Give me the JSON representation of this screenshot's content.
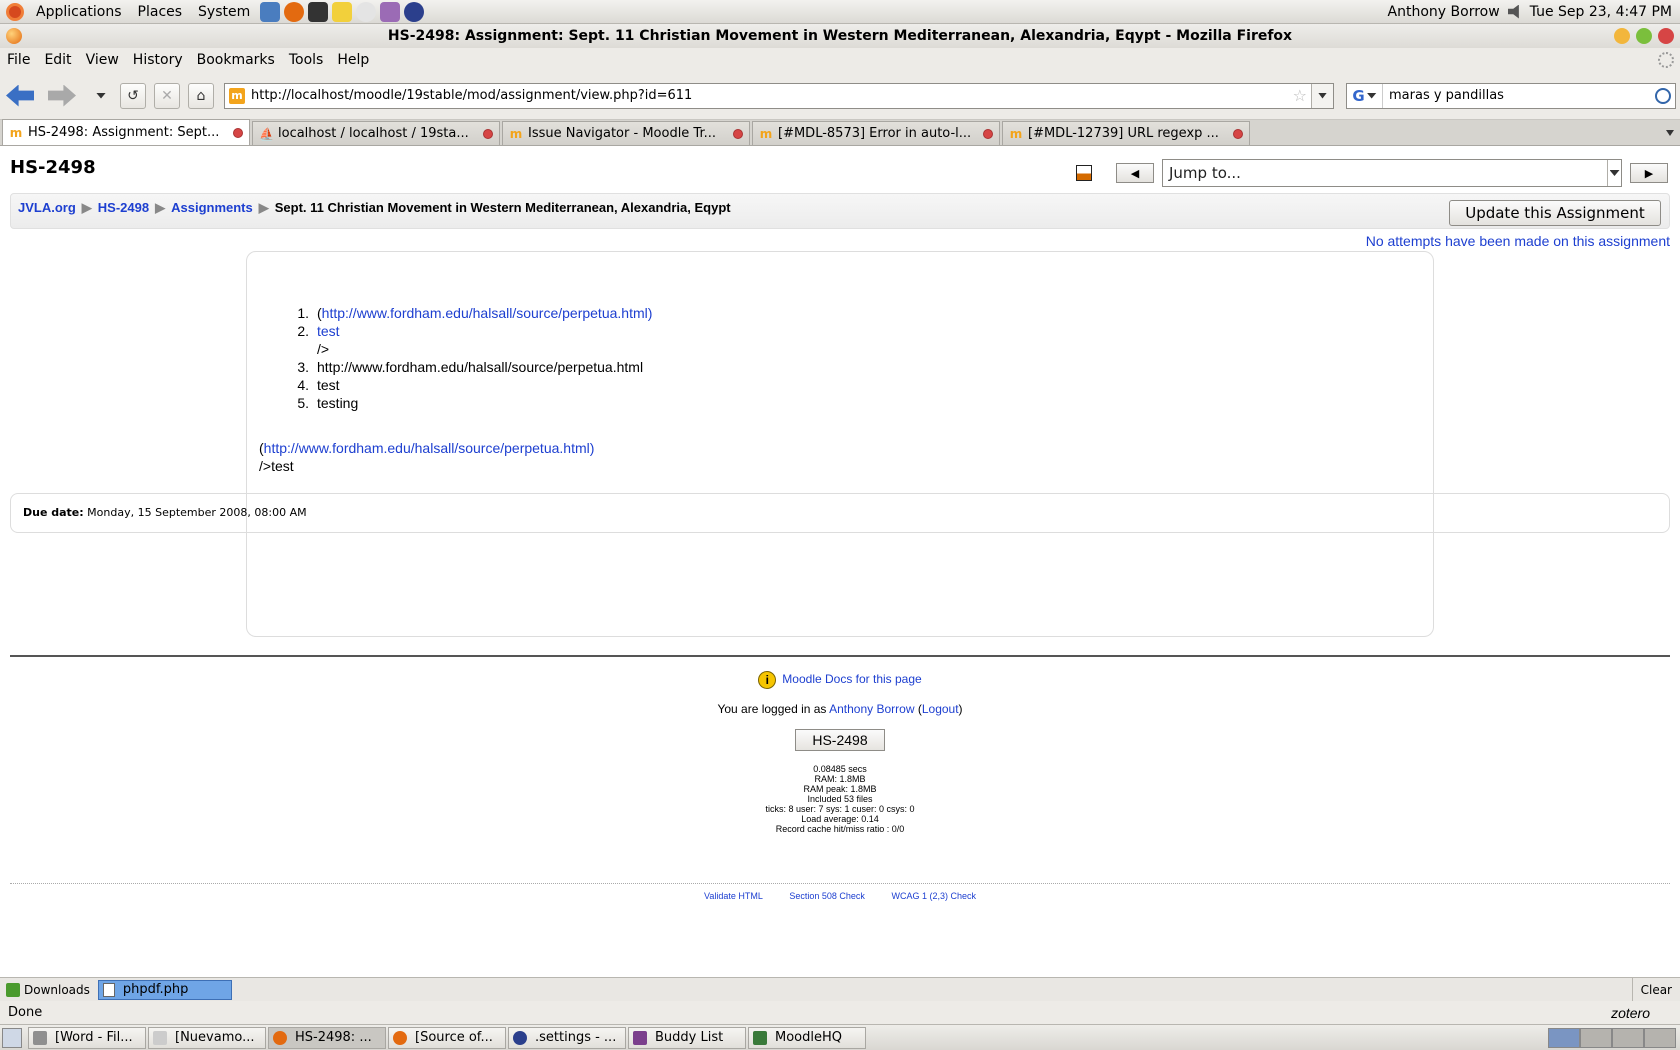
{
  "panel": {
    "menus": [
      "Applications",
      "Places",
      "System"
    ],
    "user": "Anthony Borrow",
    "datetime": "Tue Sep 23,  4:47 PM"
  },
  "window": {
    "title": "HS-2498: Assignment: Sept. 11 Christian Movement in Western Mediterranean, Alexandria, Eqypt - Mozilla Firefox"
  },
  "menubar": [
    "File",
    "Edit",
    "View",
    "History",
    "Bookmarks",
    "Tools",
    "Help"
  ],
  "nav": {
    "url": "http://localhost/moodle/19stable/mod/assignment/view.php?id=611",
    "search": "maras y pandillas"
  },
  "tabs": [
    {
      "label": "HS-2498: Assignment: Sept...",
      "active": true
    },
    {
      "label": "localhost / localhost / 19sta...",
      "active": false
    },
    {
      "label": "Issue Navigator - Moodle Tr...",
      "active": false
    },
    {
      "label": "[#MDL-8573] Error in auto-l...",
      "active": false
    },
    {
      "label": "[#MDL-12739] URL regexp ...",
      "active": false
    }
  ],
  "page": {
    "course_short": "HS-2498",
    "jump_placeholder": "Jump to...",
    "breadcrumb": [
      "JVLA.org",
      "HS-2498",
      "Assignments",
      "Sept. 11 Christian Movement in Western Mediterranean, Alexandria, Eqypt"
    ],
    "update_button": "Update this Assignment",
    "attempts_link": "No attempts have been made on this assignment",
    "intro_list": [
      {
        "num": "1.",
        "prefix": "(",
        "link": "http://www.fordham.edu/halsall/source/perpetua.html)"
      },
      {
        "num": "2.",
        "prefix": "",
        "link": "test",
        "cont": "/>"
      },
      {
        "num": "3.",
        "text": "http://www.fordham.edu/halsall/source/perpetua.html"
      },
      {
        "num": "4.",
        "text": "test"
      },
      {
        "num": "5.",
        "text": "testing"
      }
    ],
    "intro_para": {
      "prefix": "(",
      "link": "http://www.fordham.edu/halsall/source/perpetua.html)",
      "line2": "/>test"
    },
    "due_label": "Due date:",
    "due_value": "Monday, 15 September 2008, 08:00 AM",
    "docs_link": "Moodle Docs for this page",
    "login_prefix": "You are logged in as",
    "login_user": "Anthony Borrow",
    "logout": "Logout",
    "home_button": "HS-2498",
    "perf": [
      "0.08485 secs",
      "RAM: 1.8MB",
      "RAM peak: 1.8MB",
      "Included 53 files",
      "ticks: 8 user: 7 sys: 1 cuser: 0 csys: 0",
      "Load average: 0.14",
      "Record cache hit/miss ratio : 0/0"
    ],
    "validators": [
      "Validate HTML",
      "Section 508 Check",
      "WCAG 1 (2,3) Check"
    ]
  },
  "downloads": {
    "label": "Downloads",
    "file": "phpdf.php",
    "clear": "Clear"
  },
  "status": {
    "text": "Done",
    "zotero": "zotero"
  },
  "taskbar": [
    {
      "label": "[Word - Fil...",
      "color": "#8f8f8f"
    },
    {
      "label": "[Nuevamo...",
      "color": "#cccccc"
    },
    {
      "label": "HS-2498: ...",
      "color": "#e36a10",
      "active": true
    },
    {
      "label": "[Source of...",
      "color": "#e36a10"
    },
    {
      "label": ".settings - ...",
      "color": "#2b3f8c"
    },
    {
      "label": "Buddy List",
      "color": "#7b3f8c"
    },
    {
      "label": "MoodleHQ",
      "color": "#3a7a3a"
    }
  ]
}
